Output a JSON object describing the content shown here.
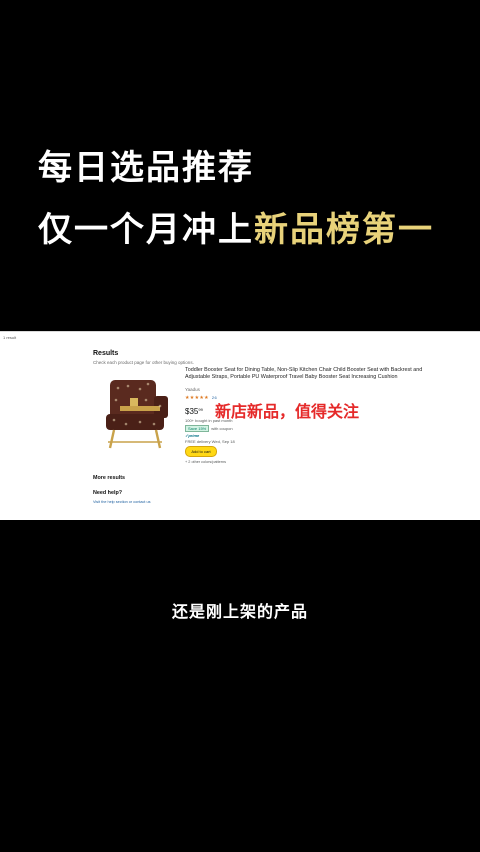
{
  "headline": {
    "line1": "每日选品推荐",
    "line2_plain": "仅一个月冲上",
    "line2_accent": "新品榜第一"
  },
  "overlay": {
    "red_text": "新店新品，值得关注",
    "caption": "还是刚上架的产品"
  },
  "page": {
    "crumb": "1 result",
    "results_title": "Results",
    "results_sub": "Check each product page for other buying options.",
    "product": {
      "title": "Toddler Booster Seat for Dining Table, Non-Slip Kitchen Chair Child Booster Seat with Backrest and Adjustable Straps, Portable PU Waterproof Travel Baby Booster Seat Increasing Cushion",
      "brand": "Yaadus",
      "stars": "★★★★★",
      "rating_count": "26",
      "price_symbol": "$",
      "price_whole": "35",
      "price_cents": "99",
      "bought": "100+ bought in past month",
      "coupon_badge": "Save 15%",
      "coupon_text": "with coupon",
      "prime": "✓prime",
      "delivery": "FREE delivery Wed, Sep 18",
      "add_button": "Add to cart",
      "more_variants": "+ 2 other colors/patterns"
    },
    "more_results": "More results",
    "need_help": "Need help?",
    "help_sub": "Visit the help section or contact us"
  },
  "colors": {
    "accent_gold": "#e8d27a",
    "overlay_red": "#e52a2a",
    "background": "#000000"
  }
}
